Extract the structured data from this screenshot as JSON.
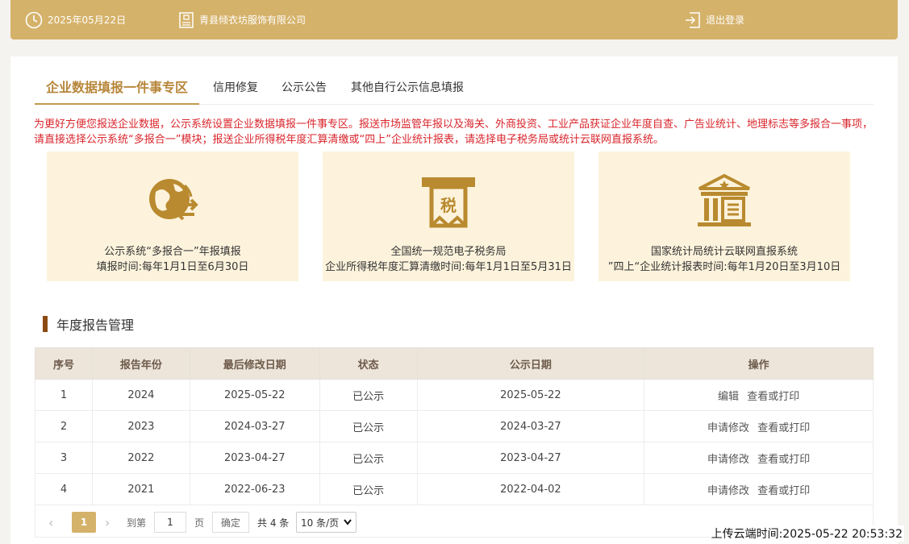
{
  "topbar": {
    "date": "2025年05月22日",
    "company": "青县倾衣坊服饰有限公司",
    "logout": "退出登录",
    "icons": {
      "date": "clock-icon",
      "company": "company-icon",
      "logout": "logout-icon"
    }
  },
  "tabs": [
    {
      "label": "企业数据填报一件事专区",
      "active": true
    },
    {
      "label": "信用修复"
    },
    {
      "label": "公示公告"
    },
    {
      "label": "其他自行公示信息填报"
    }
  ],
  "notice": "为更好方便您报送企业数据，公示系统设置企业数据填报一件事专区。报送市场监管年报以及海关、外商投资、工业产品获证企业年度自查、广告业统计、地理标志等多报合一事项，请直接选择公示系统“多报合一”模块；报送企业所得税年度汇算清缴或“四上”企业统计报表，请选择电子税务局或统计云联网直报系统。",
  "cards": [
    {
      "line1": "公示系统“多报合一”年报填报",
      "line2": "填报时间:每年1月1日至6月30日",
      "icon": "globe-exchange-icon"
    },
    {
      "line1": "全国统一规范电子税务局",
      "line2": "企业所得税年度汇算清缴时间:每年1月1日至5月31日",
      "icon": "tax-icon",
      "icon_text": "税"
    },
    {
      "line1": "国家统计局统计云联网直报系统",
      "line2": "”四上“企业统计报表时间:每年1月20日至3月10日",
      "icon": "bank-building-icon"
    }
  ],
  "section_title": "年度报告管理",
  "table": {
    "headers": [
      "序号",
      "报告年份",
      "最后修改日期",
      "状态",
      "公示日期",
      "操作"
    ],
    "rows": [
      {
        "no": "1",
        "year": "2024",
        "modified": "2025-05-22",
        "status": "已公示",
        "published": "2025-05-22",
        "op1": "编辑",
        "op2": "查看或打印"
      },
      {
        "no": "2",
        "year": "2023",
        "modified": "2024-03-27",
        "status": "已公示",
        "published": "2024-03-27",
        "op1": "申请修改",
        "op2": "查看或打印"
      },
      {
        "no": "3",
        "year": "2022",
        "modified": "2023-04-27",
        "status": "已公示",
        "published": "2023-04-27",
        "op1": "申请修改",
        "op2": "查看或打印"
      },
      {
        "no": "4",
        "year": "2021",
        "modified": "2022-06-23",
        "status": "已公示",
        "published": "2022-04-02",
        "op1": "申请修改",
        "op2": "查看或打印"
      }
    ]
  },
  "pager": {
    "prev": "‹",
    "current": "1",
    "next": "›",
    "goto_label": "到第",
    "page_value": "1",
    "page_unit": "页",
    "confirm": "确定",
    "total": "共 4 条",
    "page_size": "10 条/页"
  },
  "upload_time": "上传云端时间:2025-05-22 20:53:32",
  "colors": {
    "topbar": "#d5b26a",
    "accent": "#b7863a",
    "notice": "#d9262c",
    "card_bg": "#fdf3dc",
    "icon": "#b98a2f",
    "section_bar": "#8c4a12"
  }
}
